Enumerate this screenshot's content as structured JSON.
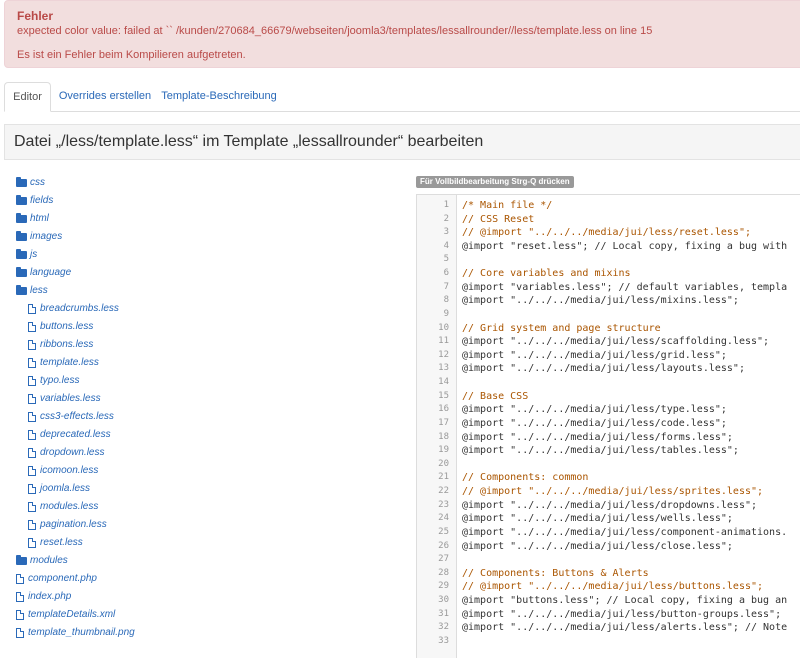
{
  "error": {
    "title": "Fehler",
    "message": "expected color value: failed at `` /kunden/270684_66679/webseiten/joomla3/templates/lessallrounder//less/template.less on line 15",
    "detail": "Es ist ein Fehler beim Kompilieren aufgetreten."
  },
  "tabs": [
    {
      "label": "Editor",
      "active": true
    },
    {
      "label": "Overrides erstellen",
      "active": false
    },
    {
      "label": "Template-Beschreibung",
      "active": false
    }
  ],
  "page_title": "Datei „/less/template.less“ im Template „lessallrounder“ bearbeiten",
  "tree": {
    "folders_top": [
      {
        "label": "css"
      },
      {
        "label": "fields"
      },
      {
        "label": "html"
      },
      {
        "label": "images"
      },
      {
        "label": "js"
      },
      {
        "label": "language"
      },
      {
        "label": "less"
      }
    ],
    "less_files": [
      {
        "label": "breadcrumbs.less"
      },
      {
        "label": "buttons.less"
      },
      {
        "label": "ribbons.less"
      },
      {
        "label": "template.less"
      },
      {
        "label": "typo.less"
      },
      {
        "label": "variables.less"
      },
      {
        "label": "css3-effects.less"
      },
      {
        "label": "deprecated.less"
      },
      {
        "label": "dropdown.less"
      },
      {
        "label": "icomoon.less"
      },
      {
        "label": "joomla.less"
      },
      {
        "label": "modules.less"
      },
      {
        "label": "pagination.less"
      },
      {
        "label": "reset.less"
      }
    ],
    "folders_bottom": [
      {
        "label": "modules"
      }
    ],
    "root_files": [
      {
        "label": "component.php"
      },
      {
        "label": "index.php"
      },
      {
        "label": "templateDetails.xml"
      },
      {
        "label": "template_thumbnail.png"
      }
    ]
  },
  "fullscreen_hint": "Für Vollbildbearbeitung Strg-Q drücken",
  "code_lines": [
    {
      "n": "1",
      "type": "comment",
      "text": "/* Main file */"
    },
    {
      "n": "2",
      "type": "comment",
      "text": "// CSS Reset"
    },
    {
      "n": "3",
      "type": "comment",
      "text": "// @import \"../../../media/jui/less/reset.less\";"
    },
    {
      "n": "4",
      "type": "code",
      "text": "@import \"reset.less\"; // Local copy, fixing a bug with"
    },
    {
      "n": "5",
      "type": "code",
      "text": ""
    },
    {
      "n": "6",
      "type": "comment",
      "text": "// Core variables and mixins"
    },
    {
      "n": "7",
      "type": "code",
      "text": "@import \"variables.less\"; // default variables, templa"
    },
    {
      "n": "8",
      "type": "code",
      "text": "@import \"../../../media/jui/less/mixins.less\";"
    },
    {
      "n": "9",
      "type": "code",
      "text": ""
    },
    {
      "n": "10",
      "type": "comment",
      "text": "// Grid system and page structure"
    },
    {
      "n": "11",
      "type": "code",
      "text": "@import \"../../../media/jui/less/scaffolding.less\";"
    },
    {
      "n": "12",
      "type": "code",
      "text": "@import \"../../../media/jui/less/grid.less\";"
    },
    {
      "n": "13",
      "type": "code",
      "text": "@import \"../../../media/jui/less/layouts.less\";"
    },
    {
      "n": "14",
      "type": "code",
      "text": ""
    },
    {
      "n": "15",
      "type": "comment",
      "text": "// Base CSS"
    },
    {
      "n": "16",
      "type": "code",
      "text": "@import \"../../../media/jui/less/type.less\";"
    },
    {
      "n": "17",
      "type": "code",
      "text": "@import \"../../../media/jui/less/code.less\";"
    },
    {
      "n": "18",
      "type": "code",
      "text": "@import \"../../../media/jui/less/forms.less\";"
    },
    {
      "n": "19",
      "type": "code",
      "text": "@import \"../../../media/jui/less/tables.less\";"
    },
    {
      "n": "20",
      "type": "code",
      "text": ""
    },
    {
      "n": "21",
      "type": "comment",
      "text": "// Components: common"
    },
    {
      "n": "22",
      "type": "comment",
      "text": "// @import \"../../../media/jui/less/sprites.less\";"
    },
    {
      "n": "23",
      "type": "code",
      "text": "@import \"../../../media/jui/less/dropdowns.less\";"
    },
    {
      "n": "24",
      "type": "code",
      "text": "@import \"../../../media/jui/less/wells.less\";"
    },
    {
      "n": "25",
      "type": "code",
      "text": "@import \"../../../media/jui/less/component-animations."
    },
    {
      "n": "26",
      "type": "code",
      "text": "@import \"../../../media/jui/less/close.less\";"
    },
    {
      "n": "27",
      "type": "code",
      "text": ""
    },
    {
      "n": "28",
      "type": "comment",
      "text": "// Components: Buttons & Alerts"
    },
    {
      "n": "29",
      "type": "comment",
      "text": "// @import \"../../../media/jui/less/buttons.less\";"
    },
    {
      "n": "30",
      "type": "code",
      "text": "@import \"buttons.less\"; // Local copy, fixing a bug an"
    },
    {
      "n": "31",
      "type": "code",
      "text": "@import \"../../../media/jui/less/button-groups.less\";"
    },
    {
      "n": "32",
      "type": "code",
      "text": "@import \"../../../media/jui/less/alerts.less\"; // Note"
    },
    {
      "n": "33",
      "type": "code",
      "text": ""
    }
  ]
}
